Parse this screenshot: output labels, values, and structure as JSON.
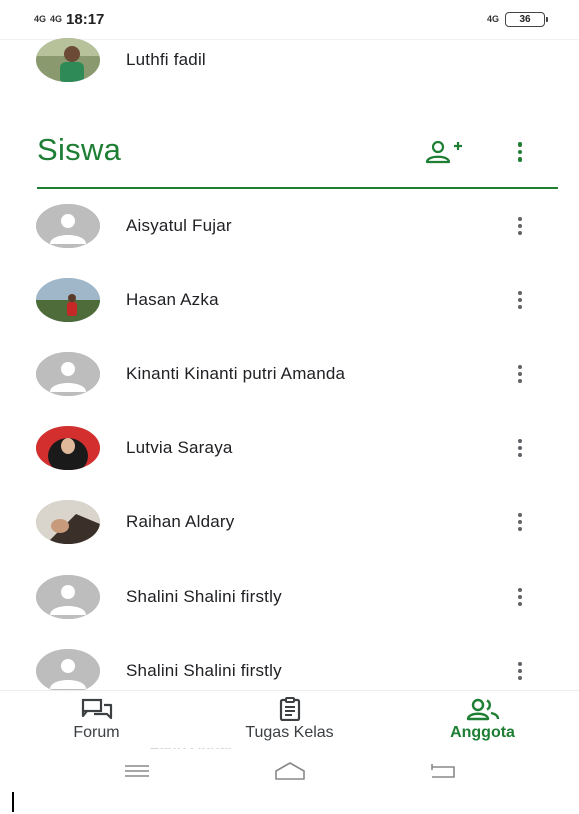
{
  "status_bar": {
    "net1": "4G",
    "net2": "4G",
    "time": "18:17",
    "net3": "4G",
    "battery": "36"
  },
  "teacher": {
    "name": "Luthfi fadil"
  },
  "section": {
    "title": "Siswa"
  },
  "students": [
    {
      "name": "Aisyatul Fujar",
      "avatar": "default-avatar"
    },
    {
      "name": "Hasan Azka",
      "avatar": "photo-outdoor"
    },
    {
      "name": "Kinanti Kinanti putri Amanda",
      "avatar": "default-avatar"
    },
    {
      "name": "Lutvia Saraya",
      "avatar": "photo-red-hijab"
    },
    {
      "name": "Raihan Aldary",
      "avatar": "photo-selfie"
    },
    {
      "name": "Shalini Shalini firstly",
      "avatar": "default-avatar"
    },
    {
      "name": "Shalini Shalini firstly",
      "avatar": "default-avatar"
    }
  ],
  "bottom_nav": {
    "items": [
      {
        "label": "Forum",
        "icon": "forum-icon",
        "active": false
      },
      {
        "label": "Tugas Kelas",
        "icon": "classwork-icon",
        "active": false
      },
      {
        "label": "Anggota",
        "icon": "people-icon",
        "active": true
      }
    ]
  },
  "ghost_text": "Zahri Ahnar",
  "colors": {
    "accent": "#1e7e34",
    "icon_gray": "#5f6368",
    "avatar_gray": "#bdbdbd"
  }
}
